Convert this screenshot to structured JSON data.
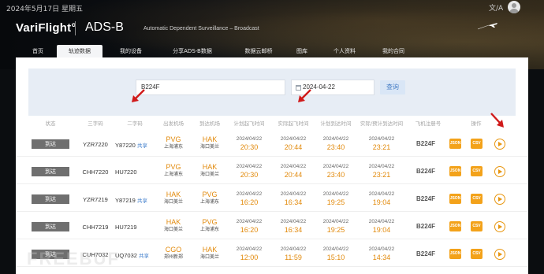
{
  "topbar": {
    "date": "2024年5月17日 星期五"
  },
  "brand": {
    "logo": "VariFlight°",
    "product": "ADS-B",
    "subtitle": "Automatic Dependent Surveillance – Broadcast"
  },
  "nav": {
    "items": [
      "首页",
      "轨迹数据",
      "我的设备",
      "分享ADS-B数据",
      "数据云邮桥",
      "图库",
      "个人资料",
      "我的合同"
    ],
    "active": "轨迹数据"
  },
  "search": {
    "flight_value": "B224F",
    "date_value": "2024-04-22",
    "query_label": "查询"
  },
  "table": {
    "headers": [
      "状态",
      "三字码",
      "二字码",
      "出发机场",
      "到达机场",
      "计划起飞时间",
      "实际起飞时间",
      "计划到达时间",
      "实际/预计到达时间",
      "飞机注册号",
      "操作"
    ],
    "rows": [
      {
        "status": "到达",
        "icao": "YZR7220",
        "iata": "Y87220",
        "share": "共享",
        "dep_code": "PVG",
        "dep_name": "上海浦东",
        "arr_code": "HAK",
        "arr_name": "海口美兰",
        "sched_dep_date": "2024/04/22",
        "sched_dep": "20:30",
        "act_dep_date": "2024/04/22",
        "act_dep": "20:44",
        "sched_arr_date": "2024/04/22",
        "sched_arr": "23:40",
        "act_arr_date": "2024/04/22",
        "act_arr": "23:21",
        "reg": "B224F"
      },
      {
        "status": "到达",
        "icao": "CHH7220",
        "iata": "HU7220",
        "share": "",
        "dep_code": "PVG",
        "dep_name": "上海浦东",
        "arr_code": "HAK",
        "arr_name": "海口美兰",
        "sched_dep_date": "2024/04/22",
        "sched_dep": "20:30",
        "act_dep_date": "2024/04/22",
        "act_dep": "20:44",
        "sched_arr_date": "2024/04/22",
        "sched_arr": "23:40",
        "act_arr_date": "2024/04/22",
        "act_arr": "23:21",
        "reg": "B224F"
      },
      {
        "status": "到达",
        "icao": "YZR7219",
        "iata": "Y87219",
        "share": "共享",
        "dep_code": "HAK",
        "dep_name": "海口美兰",
        "arr_code": "PVG",
        "arr_name": "上海浦东",
        "sched_dep_date": "2024/04/22",
        "sched_dep": "16:20",
        "act_dep_date": "2024/04/22",
        "act_dep": "16:34",
        "sched_arr_date": "2024/04/22",
        "sched_arr": "19:25",
        "act_arr_date": "2024/04/22",
        "act_arr": "19:04",
        "reg": "B224F"
      },
      {
        "status": "到达",
        "icao": "CHH7219",
        "iata": "HU7219",
        "share": "",
        "dep_code": "HAK",
        "dep_name": "海口美兰",
        "arr_code": "PVG",
        "arr_name": "上海浦东",
        "sched_dep_date": "2024/04/22",
        "sched_dep": "16:20",
        "act_dep_date": "2024/04/22",
        "act_dep": "16:34",
        "sched_arr_date": "2024/04/22",
        "sched_arr": "19:25",
        "act_arr_date": "2024/04/22",
        "act_arr": "19:04",
        "reg": "B224F"
      },
      {
        "status": "到达",
        "icao": "CUH7032",
        "iata": "UQ7032",
        "share": "共享",
        "dep_code": "CGO",
        "dep_name": "郑州新郑",
        "arr_code": "HAK",
        "arr_name": "海口美兰",
        "sched_dep_date": "2024/04/22",
        "sched_dep": "12:00",
        "act_dep_date": "2024/04/22",
        "act_dep": "11:59",
        "sched_arr_date": "2024/04/22",
        "sched_arr": "15:10",
        "act_arr_date": "2024/04/22",
        "act_arr": "14:34",
        "reg": "B224F"
      }
    ],
    "actions": {
      "json": "JSON",
      "csv": "CSV"
    }
  },
  "watermark": "FREEBUF",
  "colors": {
    "accent": "#e28a0c",
    "link": "#3c7ccb",
    "badge": "#6f6f6f",
    "arrow": "#d01a1a"
  }
}
